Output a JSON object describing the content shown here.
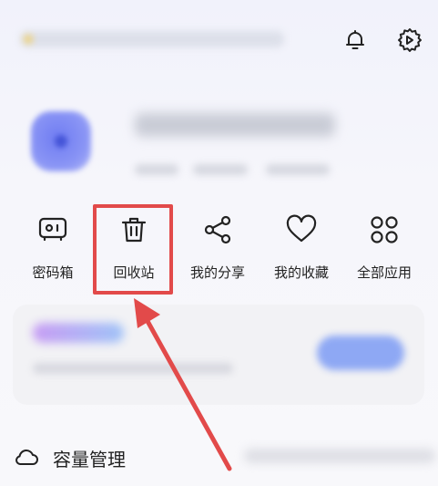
{
  "header": {
    "bell_icon": "bell-icon",
    "settings_icon": "settings-icon"
  },
  "shortcuts": [
    {
      "label": "密码箱",
      "icon": "safe-icon"
    },
    {
      "label": "回收站",
      "icon": "trash-icon"
    },
    {
      "label": "我的分享",
      "icon": "share-icon"
    },
    {
      "label": "我的收藏",
      "icon": "heart-icon"
    },
    {
      "label": "全部应用",
      "icon": "grid-icon"
    }
  ],
  "storage": {
    "label": "容量管理",
    "icon": "cloud-icon"
  },
  "colors": {
    "highlight": "#e24a4a",
    "arrow": "#e24a4a"
  }
}
